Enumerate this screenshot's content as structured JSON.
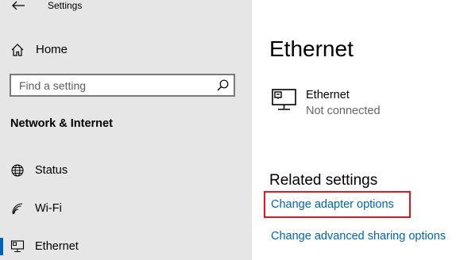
{
  "header": {
    "back_icon": "back-arrow-icon",
    "app_title": "Settings"
  },
  "sidebar": {
    "home_label": "Home",
    "home_icon": "home-icon",
    "search": {
      "placeholder": "Find a setting",
      "icon": "search-icon"
    },
    "section_title": "Network & Internet",
    "items": [
      {
        "label": "Status",
        "icon": "globe-icon",
        "active": false
      },
      {
        "label": "Wi-Fi",
        "icon": "wifi-icon",
        "active": false
      },
      {
        "label": "Ethernet",
        "icon": "ethernet-monitor-icon",
        "active": true
      }
    ]
  },
  "main": {
    "page_title": "Ethernet",
    "connection": {
      "icon": "ethernet-monitor-icon",
      "name": "Ethernet",
      "status": "Not connected"
    },
    "related_settings_title": "Related settings",
    "links": [
      {
        "label": "Change adapter options",
        "highlighted": true
      },
      {
        "label": "Change advanced sharing options",
        "highlighted": false
      }
    ]
  },
  "colors": {
    "sidebar_bg": "#e6e6e6",
    "accent": "#0063b1",
    "link": "#0063b1",
    "highlight": "#e8161b",
    "secondary_text": "#666666"
  }
}
